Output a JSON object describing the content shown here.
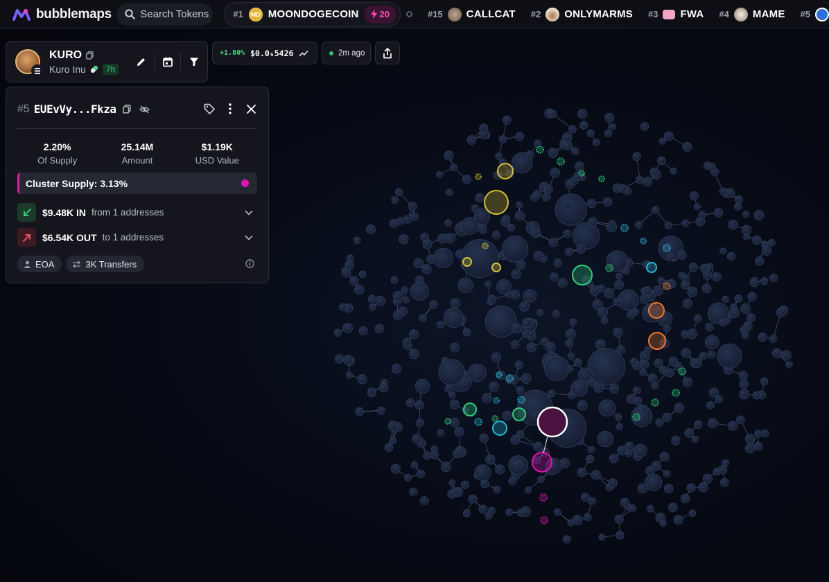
{
  "brand": {
    "name": "bubblemaps"
  },
  "search": {
    "label": "Search Tokens"
  },
  "trending": {
    "active": {
      "rank": "#1",
      "name": "MOONDOGECOIN",
      "avatar_text": "MD",
      "boost": "20"
    },
    "items": [
      {
        "rank": "#15",
        "name": "CALLCAT"
      },
      {
        "rank": "#2",
        "name": "ONLYMARMS"
      },
      {
        "rank": "#3",
        "name": "FWA"
      },
      {
        "rank": "#4",
        "name": "MAME"
      },
      {
        "rank": "#5",
        "name": ""
      }
    ]
  },
  "token": {
    "symbol": "KURO",
    "name": "Kuro Inu",
    "age": "7h"
  },
  "price": {
    "change": "+1.80%",
    "value": "$0.0₅5426"
  },
  "updated": {
    "label": "2m ago"
  },
  "wallet": {
    "rank": "#5",
    "address": "EUEvVy...Fkza",
    "stats": [
      {
        "value": "2.20%",
        "label": "Of Supply"
      },
      {
        "value": "25.14M",
        "label": "Amount"
      },
      {
        "value": "$1.19K",
        "label": "USD Value"
      }
    ],
    "cluster_supply": "Cluster Supply: 3.13%",
    "inflow": {
      "amount": "$9.48K IN",
      "detail": "from 1 addresses"
    },
    "outflow": {
      "amount": "$6.54K OUT",
      "detail": "to 1 addresses"
    },
    "tags": {
      "type": "EOA",
      "transfers": "3K Transfers"
    }
  },
  "colors": {
    "accent": "#e214b0",
    "cluster_yellow": "#d8c22f",
    "cluster_green": "#2ed07f",
    "cluster_cyan": "#27b8d6",
    "cluster_orange": "#f07a2a",
    "bubble": "#1c2740",
    "positive": "#3ddc84"
  },
  "icons": [
    "search-icon",
    "copy-icon",
    "pill-icon",
    "pencil-icon",
    "calendar-icon",
    "filter-icon",
    "trend-line-icon",
    "share-icon",
    "tag-icon",
    "more-vertical-icon",
    "close-icon",
    "hide-icon",
    "arrow-in-icon",
    "arrow-out-icon",
    "chevron-down-icon",
    "user-icon",
    "transfer-icon",
    "info-icon",
    "lightning-icon"
  ]
}
